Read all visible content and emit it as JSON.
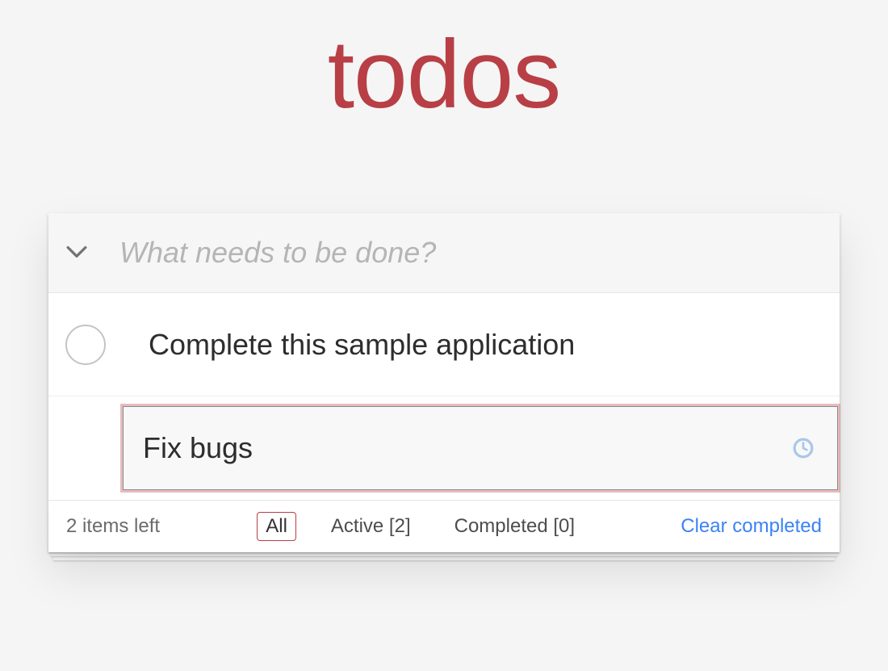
{
  "title": "todos",
  "input": {
    "placeholder": "What needs to be done?",
    "value": ""
  },
  "todos": [
    {
      "label": "Complete this sample application",
      "completed": false,
      "editing": false
    },
    {
      "label": "Fix bugs",
      "completed": false,
      "editing": true
    }
  ],
  "footer": {
    "count_text": "2 items left",
    "filters": {
      "all": {
        "label": "All",
        "selected": true
      },
      "active": {
        "label": "Active [2]",
        "selected": false
      },
      "completed": {
        "label": "Completed [0]",
        "selected": false
      }
    },
    "clear_label": "Clear completed"
  }
}
